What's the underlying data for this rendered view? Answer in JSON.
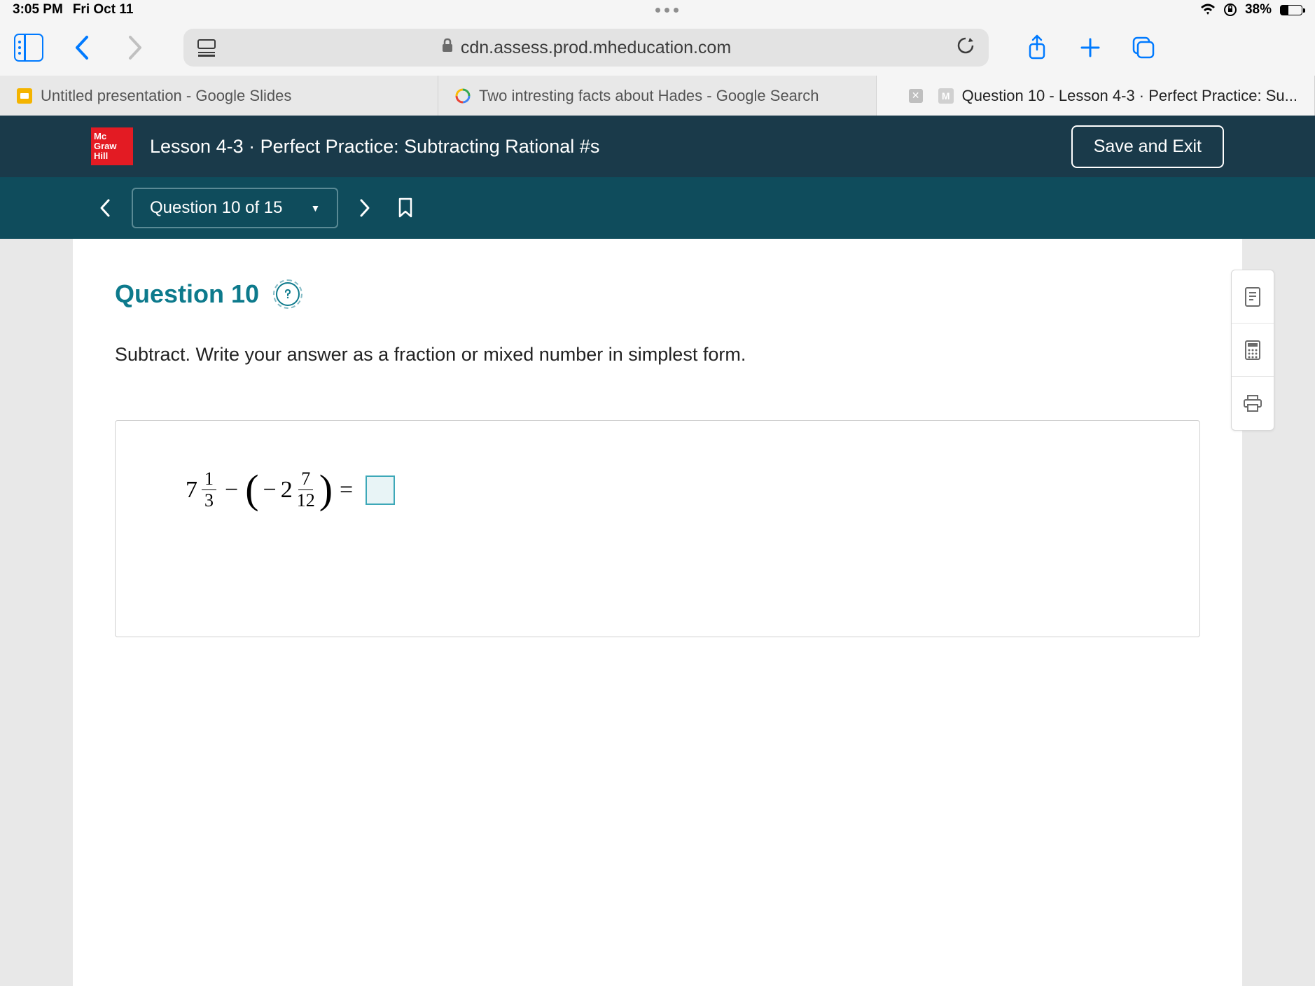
{
  "status_bar": {
    "time": "3:05 PM",
    "date": "Fri Oct 11",
    "battery_pct": "38%"
  },
  "safari": {
    "url": "cdn.assess.prod.mheducation.com"
  },
  "tabs": {
    "tab1": "Untitled presentation - Google Slides",
    "tab2": "Two intresting facts about Hades - Google Search",
    "tab3": "Question 10 - Lesson 4-3 · Perfect Practice: Su..."
  },
  "app": {
    "logo_line1": "Mc",
    "logo_line2": "Graw",
    "logo_line3": "Hill",
    "lesson_title": "Lesson 4-3 · Perfect Practice: Subtracting Rational #s",
    "save_exit": "Save and Exit"
  },
  "nav": {
    "question_label": "Question 10 of 15"
  },
  "question": {
    "title": "Question 10",
    "instruction": "Subtract. Write your answer as a fraction or mixed number in simplest form.",
    "eq_whole1": "7",
    "eq_num1": "1",
    "eq_den1": "3",
    "eq_minus": "−",
    "eq_neg": "−",
    "eq_whole2": "2",
    "eq_num2": "7",
    "eq_den2": "12",
    "eq_equals": "="
  }
}
